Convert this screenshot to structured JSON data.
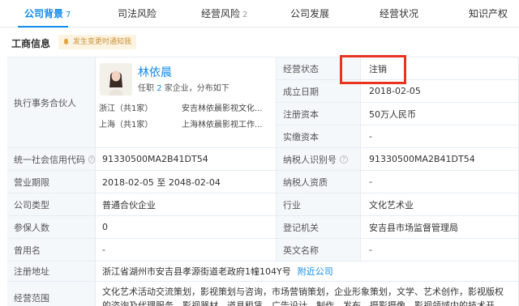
{
  "tabs": [
    {
      "label": "公司背景",
      "count": "7"
    },
    {
      "label": "司法风险",
      "count": ""
    },
    {
      "label": "经营风险",
      "count": "2"
    },
    {
      "label": "公司发展",
      "count": ""
    },
    {
      "label": "经营状况",
      "count": ""
    },
    {
      "label": "知识产权",
      "count": ""
    }
  ],
  "section": {
    "title": "工商信息",
    "notice": "发生变更时通知我"
  },
  "partner": {
    "label": "执行事务合伙人",
    "name": "林依晨",
    "meta_prefix": "任职",
    "meta_count": "2",
    "meta_suffix": "家企业，分布如下",
    "locations": [
      {
        "region": "浙江（共1家）",
        "company": "安吉林依晨影视文化..."
      },
      {
        "region": "上海（共1家）",
        "company": "上海林依晨影视工作..."
      }
    ]
  },
  "right_rows": [
    {
      "label": "经营状态",
      "value": "注销"
    },
    {
      "label": "成立日期",
      "value": "2018-02-05"
    },
    {
      "label": "注册资本",
      "value": "50万人民币"
    },
    {
      "label": "实缴资本",
      "value": "-"
    }
  ],
  "rows": [
    {
      "l1": "统一社会信用代码",
      "v1": "91330500MA2B41DT54",
      "l2": "纳税人识别号",
      "v2": "91330500MA2B41DT54"
    },
    {
      "l1": "营业期限",
      "v1": "2018-02-05 至 2048-02-04",
      "l2": "纳税人资质",
      "v2": "-"
    },
    {
      "l1": "公司类型",
      "v1": "普通合伙企业",
      "l2": "行业",
      "v2": "文化艺术业"
    },
    {
      "l1": "参保人数",
      "v1": "0",
      "l2": "登记机关",
      "v2": "安吉县市场监督管理局"
    },
    {
      "l1": "曾用名",
      "v1": "-",
      "l2": "英文名称",
      "v2": "-"
    }
  ],
  "address": {
    "label": "注册地址",
    "value": "浙江省湖州市安吉县孝源街道老政府1幢104Y号",
    "link": "附近公司"
  },
  "scope": {
    "label": "经营范围",
    "value": "文化艺术活动交流策划，影视策划与咨询，市场营销策划，企业形象策划，文学、艺术创作，影视版权的咨询及代理服务，影视器材、道具租赁，广告设计、制作、发布，摄影摄像，影视领域内的技术开发、技术服务、技术咨询，会务服务"
  },
  "colors": {
    "accent": "#128bed",
    "highlight_box": "#e8341f",
    "label_bg": "#f5f8fb",
    "notice_text": "#c8923a"
  },
  "icons": {
    "notice": "bell-icon",
    "help": "help-circle-icon"
  }
}
